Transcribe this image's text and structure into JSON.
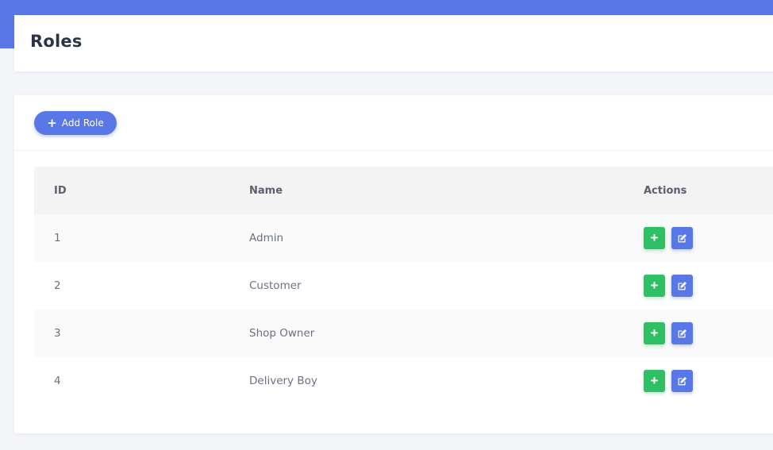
{
  "colors": {
    "primary": "#5a77e8",
    "success": "#2fbf64",
    "background": "#f4f5f9",
    "card": "#ffffff"
  },
  "header": {
    "title": "Roles"
  },
  "toolbar": {
    "add_role_label": "Add Role",
    "add_icon": "plus-icon"
  },
  "table": {
    "columns": [
      "ID",
      "Name",
      "Actions"
    ],
    "rows": [
      {
        "id": "1",
        "name": "Admin"
      },
      {
        "id": "2",
        "name": "Customer"
      },
      {
        "id": "3",
        "name": "Shop Owner"
      },
      {
        "id": "4",
        "name": "Delivery Boy"
      }
    ],
    "row_actions": [
      {
        "icon": "plus-icon",
        "color": "#2fbf64"
      },
      {
        "icon": "edit-icon",
        "color": "#5a77e8"
      }
    ]
  }
}
